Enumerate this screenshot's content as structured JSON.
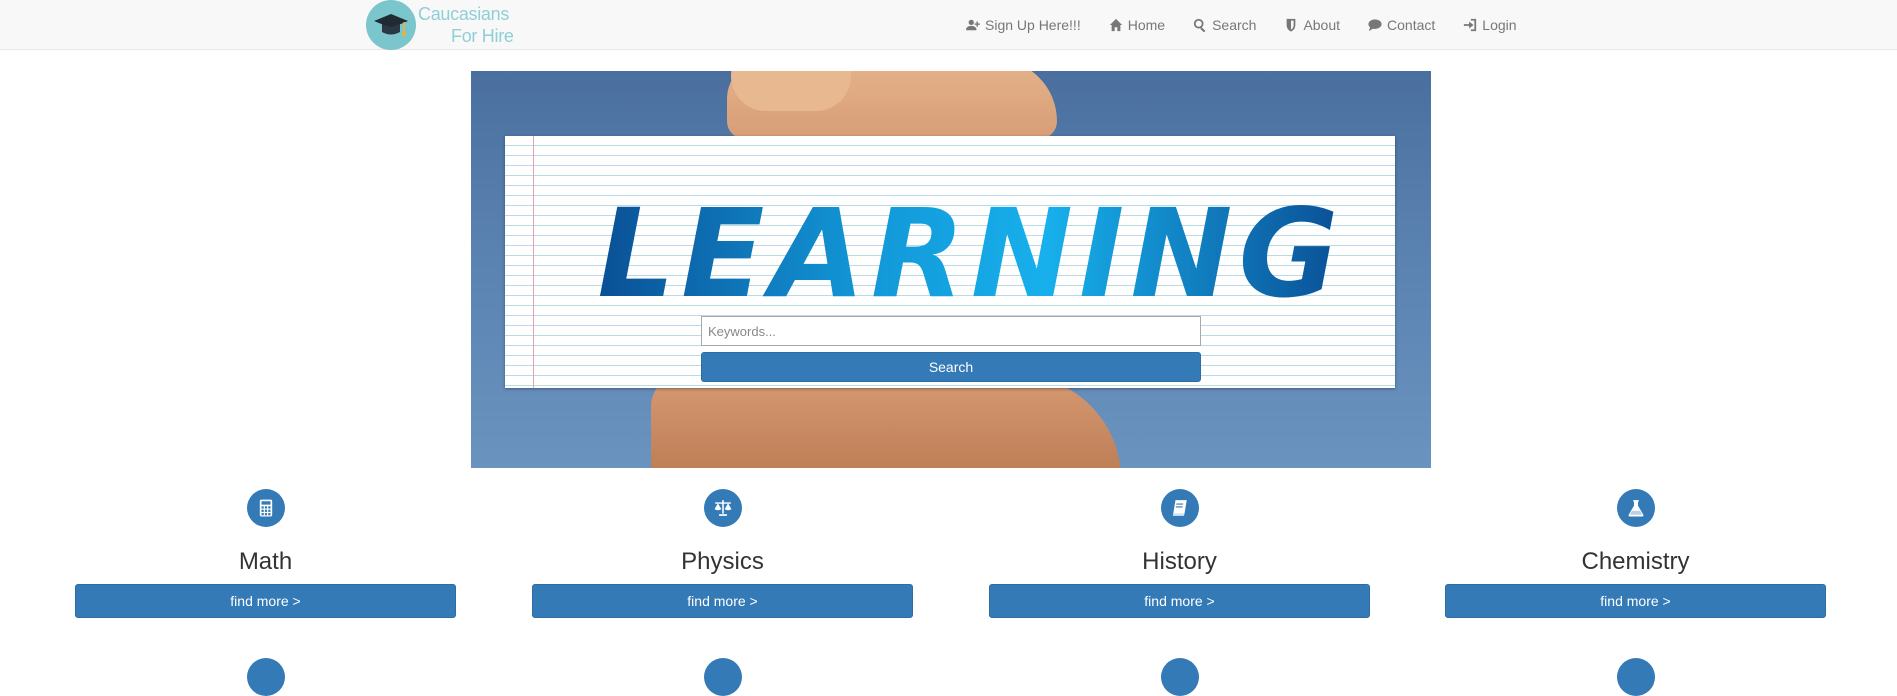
{
  "brand": {
    "line1": "Caucasians",
    "line2": "For Hire"
  },
  "nav": {
    "items": [
      {
        "label": "Sign Up Here!!!",
        "icon": "user-plus-icon"
      },
      {
        "label": "Home",
        "icon": "home-icon"
      },
      {
        "label": "Search",
        "icon": "search-icon"
      },
      {
        "label": "About",
        "icon": "shield-icon"
      },
      {
        "label": "Contact",
        "icon": "comment-icon"
      },
      {
        "label": "Login",
        "icon": "sign-in-icon"
      }
    ]
  },
  "hero": {
    "banner_text": "LEARNING",
    "search_placeholder": "Keywords...",
    "search_value": "",
    "search_button": "Search"
  },
  "subjects": [
    {
      "title": "Math",
      "button": "find more >",
      "icon": "calculator-icon"
    },
    {
      "title": "Physics",
      "button": "find more >",
      "icon": "balance-scale-icon"
    },
    {
      "title": "History",
      "button": "find more >",
      "icon": "book-icon"
    },
    {
      "title": "Chemistry",
      "button": "find more >",
      "icon": "flask-icon"
    }
  ],
  "colors": {
    "primary": "#337ab7",
    "navbar_bg": "#f8f8f8",
    "brand_text": "#8fcfd6",
    "nav_text": "#777777"
  }
}
